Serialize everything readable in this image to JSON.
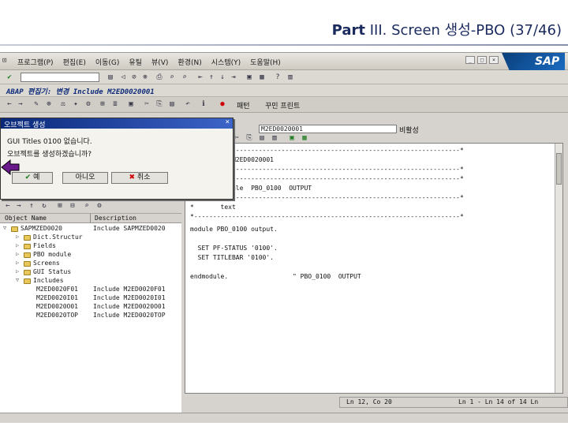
{
  "slide": {
    "title_bold": "Part",
    "title_rest": " III. Screen 생성-PBO (37/46)"
  },
  "menubar": {
    "items": [
      "프로그램(P)",
      "편집(E)",
      "이동(G)",
      "유틸",
      "뷰(V)",
      "환경(N)",
      "시스템(Y)",
      "도움말(H)"
    ],
    "logo": "SAP"
  },
  "screen": {
    "title": "ABAP 편집기: 변경 Include M2ED0020001",
    "app_toolbar": {
      "pattern_label": "패턴",
      "pretty_label": "꾸민 프린트"
    }
  },
  "editor": {
    "module_value": "M2ED0020001",
    "status_label": "비활성",
    "code_lines": [
      "*----------------------------------------------------------------------*",
      "*  INCLUDE M2ED0020001",
      "*----------------------------------------------------------------------*",
      "*&---------------------------------------------------------------------*",
      "*&      Module  PBO_0100  OUTPUT",
      "*&---------------------------------------------------------------------*",
      "*       text",
      "*----------------------------------------------------------------------*",
      "module PBO_0100 output.",
      "",
      "  SET PF-STATUS '0100'.",
      "  SET TITLEBAR '0100'.",
      "",
      "endmodule.                 \" PBO_0100  OUTPUT"
    ],
    "cursor_pos": "Ln 12, Co 20",
    "line_range": "Ln 1 - Ln 14 of 14 Ln"
  },
  "popup": {
    "title": "오브젝트 생성",
    "message_line1": "GUI Titles 0100 없습니다.",
    "message_line2": "오브젝트를 생성하겠습니까?",
    "yes_label": "예",
    "no_label": "아니오",
    "cancel_label": "취소"
  },
  "tree": {
    "col_name": "Object Name",
    "col_desc": "Description",
    "rows": [
      {
        "name": "SAPMZED0020",
        "desc": "Include SAPMZED0020"
      },
      {
        "name": "Dict.Structur",
        "desc": ""
      },
      {
        "name": "Fields",
        "desc": ""
      },
      {
        "name": "PBO module",
        "desc": ""
      },
      {
        "name": "Screens",
        "desc": ""
      },
      {
        "name": "GUI Status",
        "desc": ""
      },
      {
        "name": "Includes",
        "desc": ""
      },
      {
        "name": "M2ED0020F01",
        "desc": "Include M2ED0020F01"
      },
      {
        "name": "M2ED0020I01",
        "desc": "Include M2ED0020I01"
      },
      {
        "name": "M2ED0020O01",
        "desc": "Include M2ED0020O01"
      },
      {
        "name": "M2ED0020TOP",
        "desc": "Include M2ED0020TOP"
      }
    ]
  }
}
